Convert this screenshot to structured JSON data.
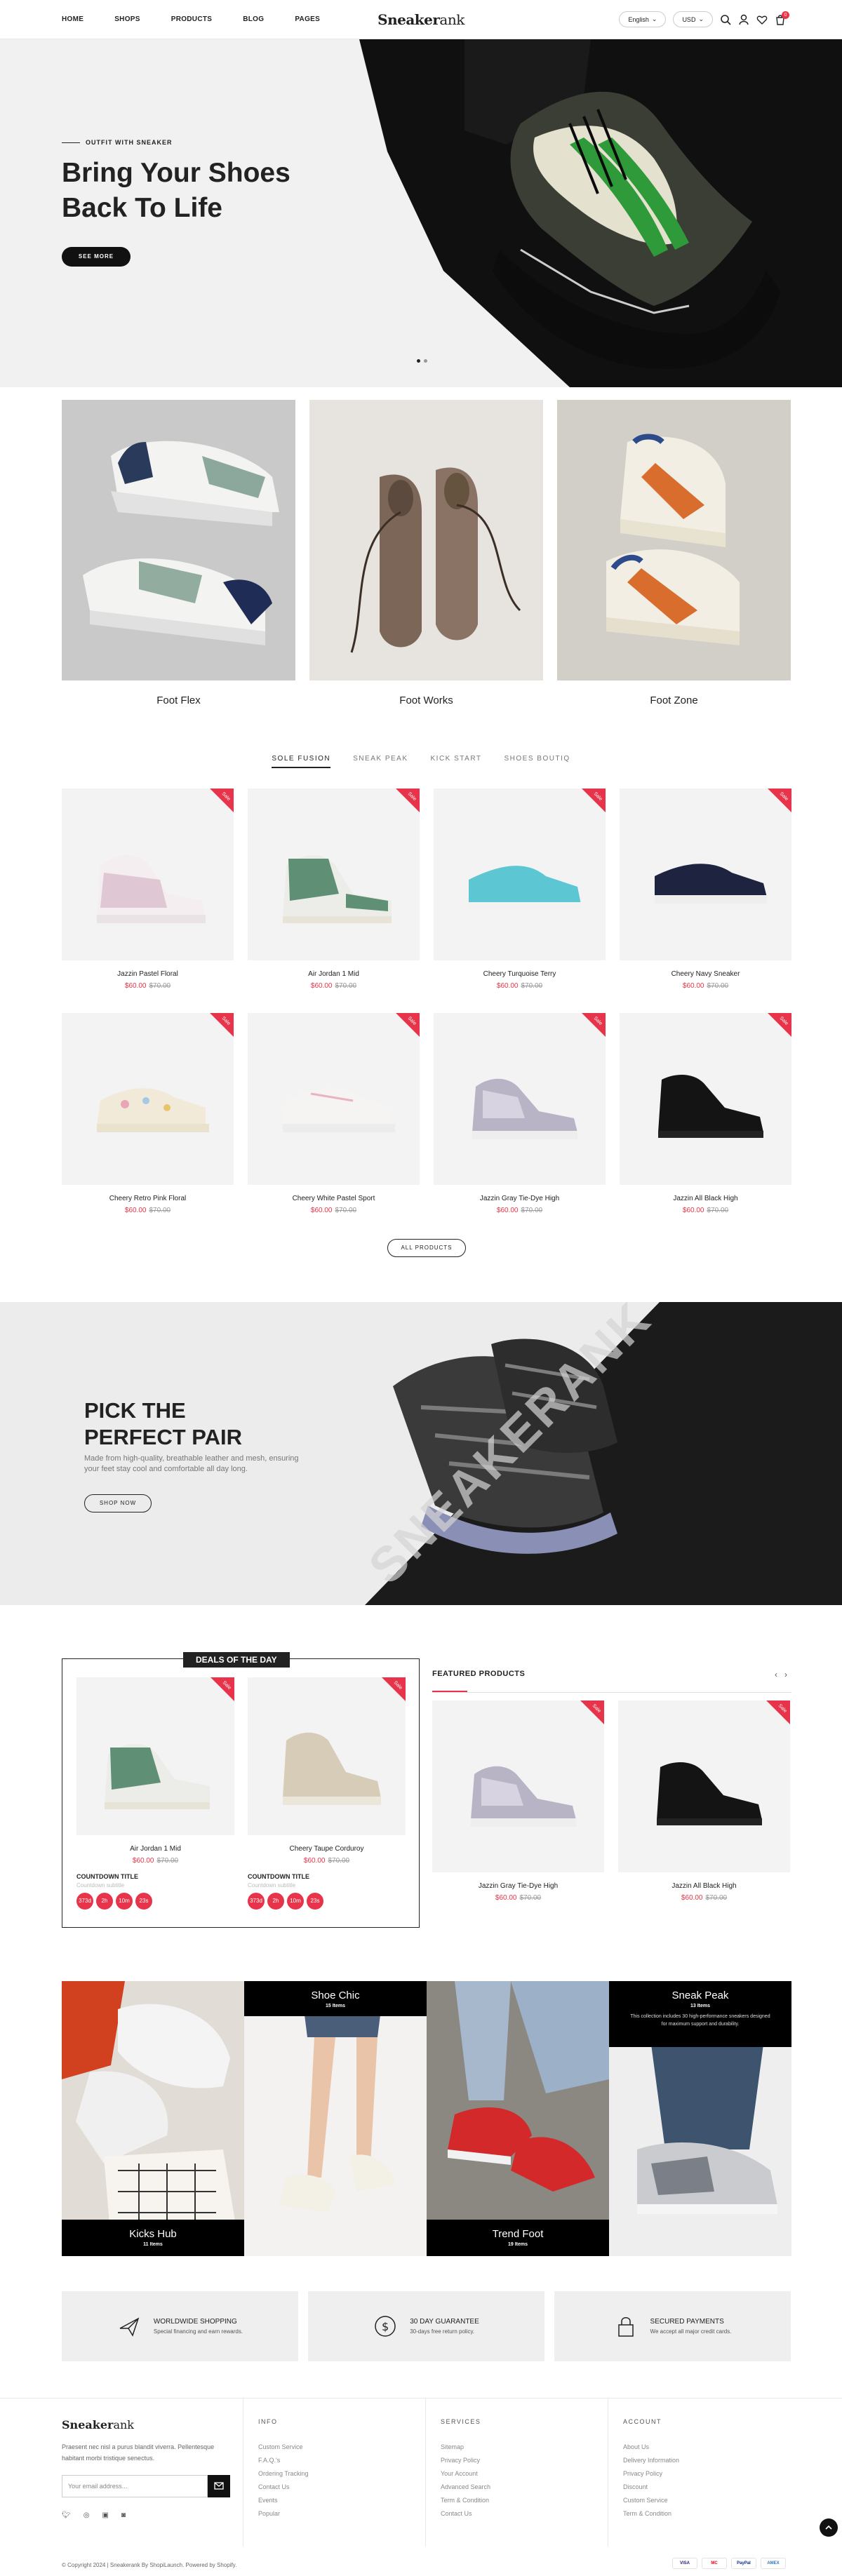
{
  "header": {
    "nav": [
      "HOME",
      "SHOPS",
      "PRODUCTS",
      "BLOG",
      "PAGES"
    ],
    "logo_a": "Sneaker",
    "logo_b": "ank",
    "language": "English",
    "currency": "USD",
    "cart_count": "0"
  },
  "hero": {
    "kicker": "OUTFIT WITH SNEAKER",
    "title": "Bring Your Shoes Back To Life",
    "button": "SEE MORE"
  },
  "categories": [
    "Foot Flex",
    "Foot Works",
    "Foot Zone"
  ],
  "tabs": [
    "SOLE FUSION",
    "SNEAK PEAK",
    "KICK START",
    "SHOES BOUTIQ"
  ],
  "sale_label": "Sale",
  "products": [
    {
      "name": "Jazzin Pastel Floral",
      "price": "$60.00",
      "old": "$70.00"
    },
    {
      "name": "Air Jordan 1 Mid",
      "price": "$60.00",
      "old": "$70.00"
    },
    {
      "name": "Cheery Turquoise Terry",
      "price": "$60.00",
      "old": "$70.00"
    },
    {
      "name": "Cheery Navy Sneaker",
      "price": "$60.00",
      "old": "$70.00"
    },
    {
      "name": "Cheery Retro Pink Floral",
      "price": "$60.00",
      "old": "$70.00"
    },
    {
      "name": "Cheery White Pastel Sport",
      "price": "$60.00",
      "old": "$70.00"
    },
    {
      "name": "Jazzin Gray Tie-Dye High",
      "price": "$60.00",
      "old": "$70.00"
    },
    {
      "name": "Jazzin All Black High",
      "price": "$60.00",
      "old": "$70.00"
    }
  ],
  "all_products": "ALL PRODUCTS",
  "banner": {
    "title": "PICK THE PERFECT PAIR",
    "text": "Made from high-quality, breathable leather and mesh, ensuring your feet stay cool and comfortable all day long.",
    "button": "SHOP NOW",
    "watermark": "SNEAKERANK"
  },
  "deals": {
    "title": "DEALS OF THE DAY",
    "items": [
      {
        "name": "Air Jordan 1 Mid",
        "price": "$60.00",
        "old": "$70.00"
      },
      {
        "name": "Cheery Taupe Corduroy",
        "price": "$60.00",
        "old": "$70.00"
      }
    ],
    "countdown_title": "COUNTDOWN TITLE",
    "countdown_sub": "Countdown subtitle",
    "countdown": [
      "373d",
      "2h",
      "10m",
      "23s"
    ]
  },
  "featured": {
    "title": "FEATURED PRODUCTS",
    "items": [
      {
        "name": "Jazzin Gray Tie-Dye High",
        "price": "$60.00",
        "old": "$70.00"
      },
      {
        "name": "Jazzin All Black High",
        "price": "$60.00",
        "old": "$70.00"
      }
    ]
  },
  "collections": [
    {
      "name": "Kicks Hub",
      "count": "11 Items"
    },
    {
      "name": "Shoe Chic",
      "count": "15 Items"
    },
    {
      "name": "Trend Foot",
      "count": "19 Items"
    },
    {
      "name": "Sneak Peak",
      "count": "13 Items",
      "desc": "This collection includes 30 high-performance sneakers designed for maximum support and durability."
    }
  ],
  "features": [
    {
      "title": "WORLDWIDE SHOPPING",
      "sub": "Special financing and earn rewards.",
      "icon": "plane-icon"
    },
    {
      "title": "30 DAY GUARANTEE",
      "sub": "30-days free return policy.",
      "icon": "dollar-circle-icon"
    },
    {
      "title": "SECURED PAYMENTS",
      "sub": "We accept all major credit cards.",
      "icon": "lock-icon"
    }
  ],
  "footer": {
    "desc": "Praesent nec nisl a purus blandit viverra. Pellentesque habitant morbi tristique senectus.",
    "email_placeholder": "Your email address...",
    "info_title": "INFO",
    "info": [
      "Custom Service",
      "F.A.Q.'s",
      "Ordering Tracking",
      "Contact Us",
      "Events",
      "Popular"
    ],
    "services_title": "SERVICES",
    "services": [
      "Sitemap",
      "Privacy Policy",
      "Your Account",
      "Advanced Search",
      "Term & Condition",
      "Contact Us"
    ],
    "account_title": "ACCOUNT",
    "account": [
      "About Us",
      "Delivery Information",
      "Privacy Policy",
      "Discount",
      "Custom Service",
      "Term & Condition"
    ],
    "copyright": "© Copyright 2024 | Sneakerank By ShopiLaunch. Powered by Shopify.",
    "payments": [
      "VISA",
      "MC",
      "PayPal",
      "AMEX"
    ]
  },
  "colors": {
    "accent": "#e8344a",
    "dark": "#111111"
  }
}
